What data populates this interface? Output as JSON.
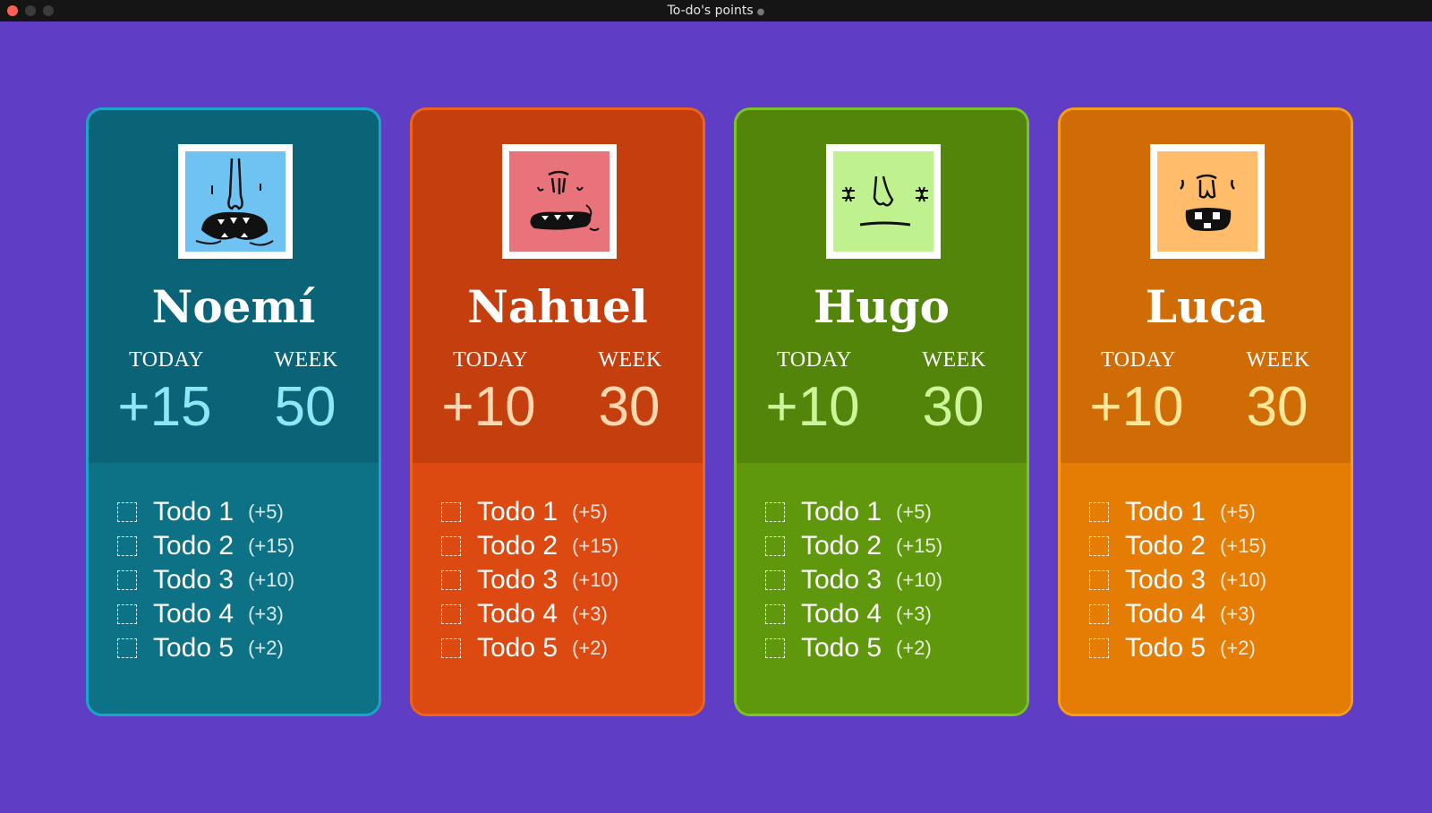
{
  "window": {
    "title": "To-do's points"
  },
  "labels": {
    "today": "TODAY",
    "week": "WEEK"
  },
  "members": [
    {
      "name": "Noemí",
      "avatar": "blue-monster-face-icon",
      "avatar_color": "#6ec3f2",
      "today": "+15",
      "week": "50",
      "todos": [
        {
          "title": "Todo 1",
          "points": "(+5)"
        },
        {
          "title": "Todo 2",
          "points": "(+15)"
        },
        {
          "title": "Todo 3",
          "points": "(+10)"
        },
        {
          "title": "Todo 4",
          "points": "(+3)"
        },
        {
          "title": "Todo 5",
          "points": "(+2)"
        }
      ]
    },
    {
      "name": "Nahuel",
      "avatar": "pink-monster-face-icon",
      "avatar_color": "#e8737a",
      "today": "+10",
      "week": "30",
      "todos": [
        {
          "title": "Todo 1",
          "points": "(+5)"
        },
        {
          "title": "Todo 2",
          "points": "(+15)"
        },
        {
          "title": "Todo 3",
          "points": "(+10)"
        },
        {
          "title": "Todo 4",
          "points": "(+3)"
        },
        {
          "title": "Todo 5",
          "points": "(+2)"
        }
      ]
    },
    {
      "name": "Hugo",
      "avatar": "green-monster-face-icon",
      "avatar_color": "#bff28f",
      "today": "+10",
      "week": "30",
      "todos": [
        {
          "title": "Todo 1",
          "points": "(+5)"
        },
        {
          "title": "Todo 2",
          "points": "(+15)"
        },
        {
          "title": "Todo 3",
          "points": "(+10)"
        },
        {
          "title": "Todo 4",
          "points": "(+3)"
        },
        {
          "title": "Todo 5",
          "points": "(+2)"
        }
      ]
    },
    {
      "name": "Luca",
      "avatar": "orange-monster-face-icon",
      "avatar_color": "#ffbd6b",
      "today": "+10",
      "week": "30",
      "todos": [
        {
          "title": "Todo 1",
          "points": "(+5)"
        },
        {
          "title": "Todo 2",
          "points": "(+15)"
        },
        {
          "title": "Todo 3",
          "points": "(+10)"
        },
        {
          "title": "Todo 4",
          "points": "(+3)"
        },
        {
          "title": "Todo 5",
          "points": "(+2)"
        }
      ]
    }
  ],
  "colors": {
    "background": "#5f3dc4",
    "card_borders": [
      "#16a8c6",
      "#f06218",
      "#7ac423",
      "#fb9d12"
    ]
  }
}
